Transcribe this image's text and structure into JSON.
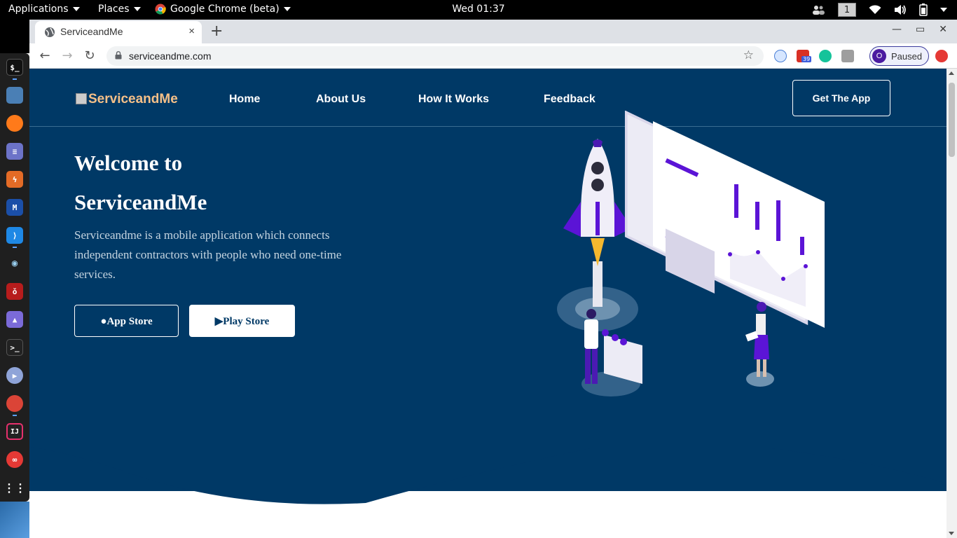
{
  "topbar": {
    "applications": "Applications",
    "places": "Places",
    "browser_app": "Google Chrome (beta)",
    "clock": "Wed 01:37",
    "workspace": "1"
  },
  "dock": {
    "icons": [
      "terminal-icon",
      "files-icon",
      "firefox-icon",
      "text-editor-icon",
      "burpsuite-icon",
      "malwarebytes-icon",
      "vscode-icon",
      "eye-icon",
      "cherrytree-icon",
      "image-viewer-icon",
      "terminal-2-icon",
      "media-player-icon",
      "chrome-icon",
      "intellij-icon",
      "glasses-app-icon",
      "show-apps-icon"
    ],
    "intellij_label": "IJ"
  },
  "browser": {
    "tab_title": "ServiceandMe",
    "tab_close": "×",
    "new_tab": "+",
    "url": "serviceandme.com",
    "ext_badge": "39",
    "profile_initial": "O",
    "profile_status": "Paused",
    "win_minimize": "—",
    "win_restore": "▭",
    "win_close": "✕"
  },
  "site": {
    "logo_text": "ServiceandMe",
    "nav": [
      "Home",
      "About Us",
      "How It Works",
      "Feedback"
    ],
    "cta": "Get The App",
    "heading_line1": "Welcome to",
    "heading_line2": "ServiceandMe",
    "description": "Serviceandme is a mobile application which connects independent contractors with people who need one-time services.",
    "app_store": "App Store",
    "play_store": "Play Store"
  },
  "colors": {
    "hero_bg": "#003966",
    "accent_purple": "#5b14d6",
    "logo_color": "#f5c088"
  }
}
